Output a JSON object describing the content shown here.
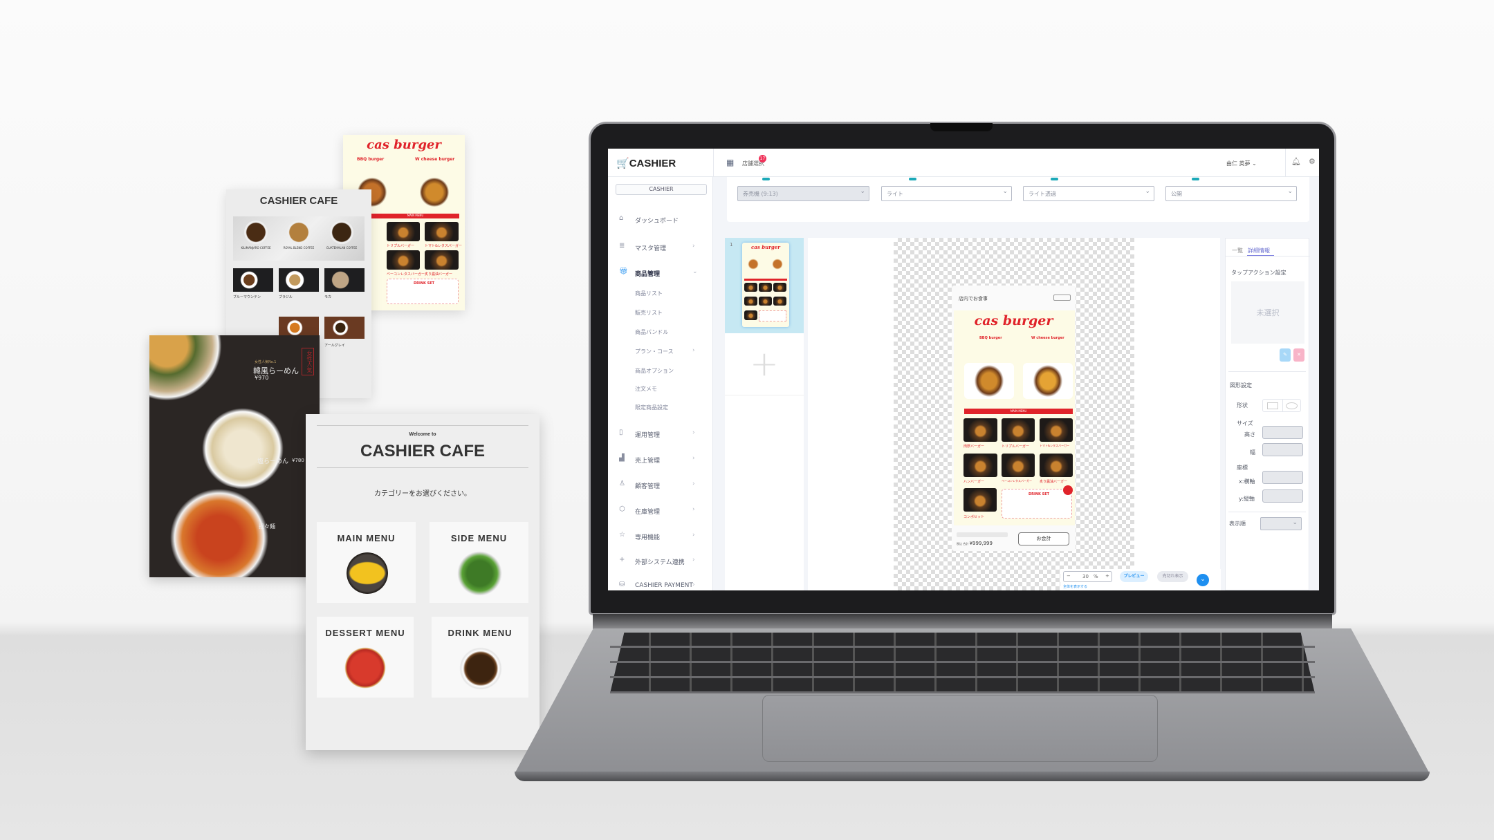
{
  "posters": {
    "burger": {
      "title": "cas burger",
      "item1": "BBQ burger",
      "item2": "W cheese burger",
      "bar": "MAIN MENU",
      "items": [
        "トリプルバーガー",
        "トマト&レタスバーガー",
        "ベーコンレタスバーガー",
        "炙り醤油バーガー"
      ],
      "drink": "DRINK SET"
    },
    "coffee": {
      "title": "CASHIER CAFE",
      "featured": [
        "KILIMANJARO COFFEE",
        "ROYAL BLEND COFFEE",
        "GUATEMALAN COFFEE"
      ],
      "items": [
        "ブルーマウンテン",
        "ブラジル",
        "モカ",
        "アールグレイ"
      ]
    },
    "ramen": {
      "tag": "女性人気No.1",
      "item1": "韓風らーめん",
      "price1": "¥970",
      "item2": "塩らーめん",
      "price2": "¥780",
      "item3": "担々麺",
      "stamp": "女性人気"
    },
    "cafe": {
      "welcome": "Welcome to",
      "title": "CASHIER CAFE",
      "prompt": "カテゴリーをお選びください。",
      "categories": [
        "MAIN MENU",
        "SIDE MENU",
        "DESSERT MENU",
        "DRINK MENU"
      ]
    }
  },
  "app": {
    "header": {
      "logo": "CASHIER",
      "store_select": "店舗選択",
      "badge": "17",
      "user": "由仁 英夢"
    },
    "sidebar": {
      "account": "CASHIER",
      "items": [
        {
          "label": "ダッシュボード",
          "icon": "home-icon",
          "chev": ""
        },
        {
          "label": "マスタ管理",
          "icon": "database-icon",
          "chev": "›"
        },
        {
          "label": "商品管理",
          "icon": "gift-icon",
          "chev": "⌄",
          "active": true
        },
        {
          "label": "商品リスト",
          "sub": true
        },
        {
          "label": "販売リスト",
          "sub": true
        },
        {
          "label": "商品バンドル",
          "sub": true
        },
        {
          "label": "プラン・コース",
          "sub": true,
          "chev": "›"
        },
        {
          "label": "商品オプション",
          "sub": true
        },
        {
          "label": "注文メモ",
          "sub": true
        },
        {
          "label": "限定商品設定",
          "sub": true
        },
        {
          "label": "運用管理",
          "icon": "clipboard-icon",
          "chev": "›"
        },
        {
          "label": "売上管理",
          "icon": "bar-chart-icon",
          "chev": "›"
        },
        {
          "label": "顧客管理",
          "icon": "user-icon",
          "chev": "›"
        },
        {
          "label": "在庫管理",
          "icon": "box-icon",
          "chev": "›"
        },
        {
          "label": "専用機能",
          "icon": "star-icon",
          "chev": "›"
        },
        {
          "label": "外部システム連携",
          "icon": "plus-icon",
          "chev": "›"
        },
        {
          "label": "CASHIER PAYMENT",
          "icon": "coins-icon",
          "chev": "›"
        }
      ]
    },
    "filters": [
      "券売機 (9:13)",
      "ライト",
      "ライト透過",
      "公開"
    ],
    "thumbnails": {
      "page": "1"
    },
    "preview": {
      "header": "店内でお食事",
      "title": "cas burger",
      "item1": "BBQ burger",
      "item2": "W cheese burger",
      "bar": "MAIN MENU",
      "items": [
        "肉厚バーガー",
        "トリプルバーガー",
        "トマト&レタスバーガー",
        "ハンバーガー",
        "ベーコンレタスバーガー",
        "炙り醤油バーガー",
        "コンボセット"
      ],
      "drink": "DRINK SET",
      "total_label": "税込 合計",
      "total": "¥999,999",
      "checkout": "お会計"
    },
    "toolbar": {
      "zoom": "30",
      "unit": "%",
      "fit": "全体を表示する",
      "preview": "プレビュー",
      "sold_out": "売切れ表示"
    },
    "panel": {
      "tabs": [
        "一覧",
        "詳細情報"
      ],
      "tap_action": "タップアクション設定",
      "unselected": "未選択",
      "shape_section": "図形設定",
      "shape": "形状",
      "size": "サイズ",
      "height": "高さ",
      "width": "幅",
      "coords": "座標",
      "x": "x:横軸",
      "y": "y:縦軸",
      "order": "表示順"
    },
    "colors": {
      "accent": "#1e8ff0",
      "red": "#e0232a"
    }
  }
}
